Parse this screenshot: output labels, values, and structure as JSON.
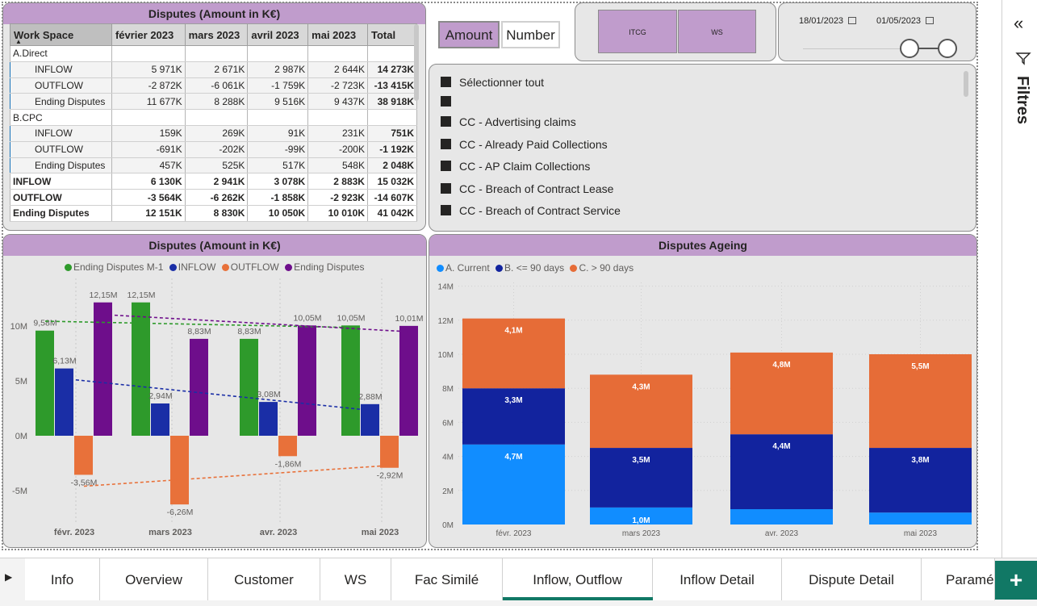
{
  "colors": {
    "accent": "#c09ccc",
    "ending_m1": "#2e9a2b",
    "inflow": "#1a2ea6",
    "outflow": "#e8713a",
    "ending": "#6e0e8b",
    "current": "#118dff",
    "le90": "#12239e",
    "gt90": "#e66c37",
    "active_tab": "#117865"
  },
  "matrix": {
    "title": "Disputes (Amount in K€)",
    "columns": [
      "Work Space",
      "février 2023",
      "mars 2023",
      "avril 2023",
      "mai 2023",
      "Total"
    ],
    "rows": [
      {
        "label": "A.Direct",
        "type": "grp",
        "values": [
          "",
          "",
          "",
          "",
          ""
        ]
      },
      {
        "label": "INFLOW",
        "type": "sub",
        "values": [
          "5 971K",
          "2 671K",
          "2 987K",
          "2 644K",
          "14 273K"
        ]
      },
      {
        "label": "OUTFLOW",
        "type": "sub",
        "values": [
          "-2 872K",
          "-6 061K",
          "-1 759K",
          "-2 723K",
          "-13 415K"
        ]
      },
      {
        "label": "Ending Disputes",
        "type": "sub",
        "values": [
          "11 677K",
          "8 288K",
          "9 516K",
          "9 437K",
          "38 918K"
        ]
      },
      {
        "label": "B.CPC",
        "type": "grp",
        "values": [
          "",
          "",
          "",
          "",
          ""
        ]
      },
      {
        "label": "INFLOW",
        "type": "sub",
        "values": [
          "159K",
          "269K",
          "91K",
          "231K",
          "751K"
        ]
      },
      {
        "label": "OUTFLOW",
        "type": "sub",
        "values": [
          "-691K",
          "-202K",
          "-99K",
          "-200K",
          "-1 192K"
        ]
      },
      {
        "label": "Ending Disputes",
        "type": "sub",
        "values": [
          "457K",
          "525K",
          "517K",
          "548K",
          "2 048K"
        ]
      },
      {
        "label": "INFLOW",
        "type": "tot",
        "values": [
          "6 130K",
          "2 941K",
          "3 078K",
          "2 883K",
          "15 032K"
        ]
      },
      {
        "label": "OUTFLOW",
        "type": "tot",
        "values": [
          "-3 564K",
          "-6 262K",
          "-1 858K",
          "-2 923K",
          "-14 607K"
        ]
      },
      {
        "label": "Ending Disputes",
        "type": "tot",
        "values": [
          "12 151K",
          "8 830K",
          "10 050K",
          "10 010K",
          "41 042K"
        ]
      }
    ]
  },
  "toggle": {
    "amount": "Amount",
    "number": "Number"
  },
  "workspaces": [
    "ITCG",
    "WS"
  ],
  "dates": {
    "start": "18/01/2023",
    "end": "01/05/2023"
  },
  "slicer": {
    "items": [
      "Sélectionner tout",
      "",
      "CC - Advertising claims",
      "CC - Already Paid Collections",
      "CC - AP Claim Collections",
      "CC - Breach of Contract Lease",
      "CC - Breach of Contract Service"
    ]
  },
  "filters_label": "Filtres",
  "tabs": [
    "Info",
    "Overview",
    "Customer",
    "WS",
    "Fac Similé",
    "Inflow, Outflow",
    "Inflow Detail",
    "Dispute Detail",
    "Paramé"
  ],
  "active_tab": "Inflow, Outflow",
  "chart_data": [
    {
      "type": "bar",
      "title": "Disputes (Amount in K€)",
      "categories": [
        "févr. 2023",
        "mars 2023",
        "avr. 2023",
        "mai 2023"
      ],
      "series": [
        {
          "name": "Ending Disputes M-1",
          "values": [
            9.58,
            12.15,
            8.83,
            10.05
          ],
          "labels": [
            "9,58M",
            "12,15M",
            "8,83M",
            "10,05M"
          ]
        },
        {
          "name": "INFLOW",
          "values": [
            6.13,
            2.94,
            3.08,
            2.88
          ],
          "labels": [
            "6,13M",
            "2,94M",
            "3,08M",
            "2,88M"
          ]
        },
        {
          "name": "OUTFLOW",
          "values": [
            -3.56,
            -6.26,
            -1.86,
            -2.92
          ],
          "labels": [
            "-3,56M",
            "-6,26M",
            "-1,86M",
            "-2,92M"
          ]
        },
        {
          "name": "Ending Disputes",
          "values": [
            12.15,
            8.83,
            10.05,
            10.01
          ],
          "labels": [
            "12,15M",
            "8,83M",
            "10,05M",
            "10,01M"
          ]
        }
      ],
      "yticks": [
        "10M",
        "5M",
        "0M",
        "-5M"
      ],
      "ylim": [
        -7.2,
        12.5
      ],
      "trendlines": true,
      "legend": "top"
    },
    {
      "type": "bar",
      "stacked": true,
      "title": "Disputes Ageing",
      "categories": [
        "févr. 2023",
        "mars 2023",
        "avr. 2023",
        "mai 2023"
      ],
      "series": [
        {
          "name": "A. Current",
          "values": [
            4.7,
            1.0,
            0.9,
            0.7
          ],
          "labels": [
            "4,7M",
            "1,0M",
            "",
            ""
          ]
        },
        {
          "name": "B. <= 90 days",
          "values": [
            3.3,
            3.5,
            4.4,
            3.8
          ],
          "labels": [
            "3,3M",
            "3,5M",
            "4,4M",
            "3,8M"
          ]
        },
        {
          "name": "C. > 90 days",
          "values": [
            4.1,
            4.3,
            4.8,
            5.5
          ],
          "labels": [
            "4,1M",
            "4,3M",
            "4,8M",
            "5,5M"
          ]
        }
      ],
      "yticks": [
        "14M",
        "12M",
        "10M",
        "8M",
        "6M",
        "4M",
        "2M",
        "0M"
      ],
      "ylim": [
        0,
        14
      ],
      "legend": "top-left"
    }
  ]
}
